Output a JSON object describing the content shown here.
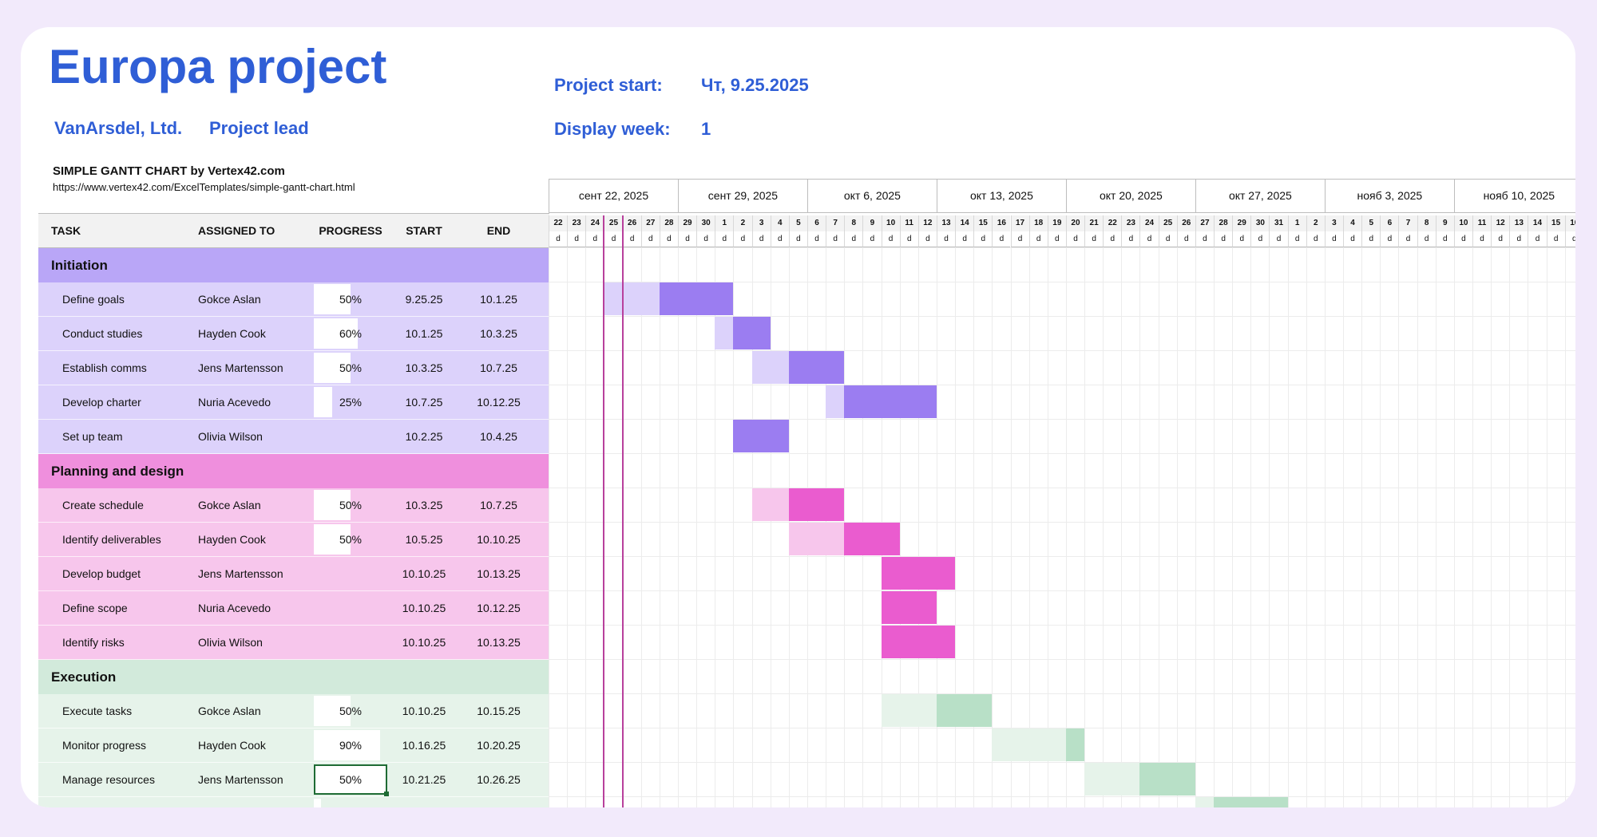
{
  "project": {
    "title": "Europa project",
    "company": "VanArsdel, Ltd.",
    "lead_label": "Project lead",
    "start_label": "Project start:",
    "start_value": "Чт, 9.25.2025",
    "week_label": "Display week:",
    "week_value": "1",
    "credit": "SIMPLE GANTT CHART by Vertex42.com",
    "credit_url": "https://www.vertex42.com/ExcelTemplates/simple-gantt-chart.html"
  },
  "columns": [
    "TASK",
    "ASSIGNED TO",
    "PROGRESS",
    "START",
    "END"
  ],
  "weeks": [
    "сент 22, 2025",
    "сент 29, 2025",
    "окт 6, 2025",
    "окт 13, 2025",
    "окт 20, 2025",
    "окт 27, 2025",
    "нояб 3, 2025",
    "нояб 10, 2025"
  ],
  "days": [
    "22",
    "23",
    "24",
    "25",
    "26",
    "27",
    "28",
    "29",
    "30",
    "1",
    "2",
    "3",
    "4",
    "5",
    "6",
    "7",
    "8",
    "9",
    "10",
    "11",
    "12",
    "13",
    "14",
    "15",
    "16",
    "17",
    "18",
    "19",
    "20",
    "21",
    "22",
    "23",
    "24",
    "25",
    "26",
    "27",
    "28",
    "29",
    "30",
    "31",
    "1",
    "2",
    "3",
    "4",
    "5",
    "6",
    "7",
    "8",
    "9",
    "10",
    "11",
    "12",
    "13",
    "14",
    "15",
    "16"
  ],
  "day_letter": "d",
  "colors": {
    "purple_header": "#b9a6f7",
    "purple_row": "#dcd2fb",
    "purple_bar": "#9b7df1",
    "purple_light": "#dcd2fb",
    "pink_header": "#ef8fdd",
    "pink_row": "#f7c6ec",
    "pink_bar": "#ea5ccf",
    "pink_light": "#f7c6ec",
    "green_header": "#d2eadb",
    "green_row": "#e6f3ea",
    "green_bar": "#b8e0c7",
    "green_light": "#e6f3ea"
  },
  "phases": [
    {
      "name": "Initiation",
      "color": "purple",
      "tasks": [
        {
          "task": "Define goals",
          "assigned": "Gokce Aslan",
          "progress": "50%",
          "progress_value": 0.5,
          "start": "9.25.25",
          "end": "10.1.25",
          "bar_light": [
            3,
            6
          ],
          "bar_dark": [
            6,
            10
          ]
        },
        {
          "task": "Conduct studies",
          "assigned": "Hayden Cook",
          "progress": "60%",
          "progress_value": 0.6,
          "start": "10.1.25",
          "end": "10.3.25",
          "bar_light": [
            9,
            10
          ],
          "bar_dark": [
            10,
            12
          ]
        },
        {
          "task": "Establish comms",
          "assigned": "Jens Martensson",
          "progress": "50%",
          "progress_value": 0.5,
          "start": "10.3.25",
          "end": "10.7.25",
          "bar_light": [
            11,
            13
          ],
          "bar_dark": [
            13,
            16
          ]
        },
        {
          "task": "Develop charter",
          "assigned": "Nuria Acevedo",
          "progress": "25%",
          "progress_value": 0.25,
          "start": "10.7.25",
          "end": "10.12.25",
          "bar_light": [
            15,
            16
          ],
          "bar_dark": [
            16,
            21
          ]
        },
        {
          "task": "Set up team",
          "assigned": "Olivia Wilson",
          "progress": "",
          "progress_value": 0,
          "start": "10.2.25",
          "end": "10.4.25",
          "bar_light": null,
          "bar_dark": [
            10,
            13
          ]
        }
      ]
    },
    {
      "name": "Planning and design",
      "color": "pink",
      "tasks": [
        {
          "task": "Create schedule",
          "assigned": "Gokce Aslan",
          "progress": "50%",
          "progress_value": 0.5,
          "start": "10.3.25",
          "end": "10.7.25",
          "bar_light": [
            11,
            13
          ],
          "bar_dark": [
            13,
            16
          ]
        },
        {
          "task": "Identify deliverables",
          "assigned": "Hayden Cook",
          "progress": "50%",
          "progress_value": 0.5,
          "start": "10.5.25",
          "end": "10.10.25",
          "bar_light": [
            13,
            16
          ],
          "bar_dark": [
            16,
            19
          ]
        },
        {
          "task": "Develop budget",
          "assigned": "Jens Martensson",
          "progress": "",
          "progress_value": 0,
          "start": "10.10.25",
          "end": "10.13.25",
          "bar_light": null,
          "bar_dark": [
            18,
            22
          ]
        },
        {
          "task": "Define scope",
          "assigned": "Nuria Acevedo",
          "progress": "",
          "progress_value": 0,
          "start": "10.10.25",
          "end": "10.12.25",
          "bar_light": null,
          "bar_dark": [
            18,
            21
          ]
        },
        {
          "task": "Identify risks",
          "assigned": "Olivia Wilson",
          "progress": "",
          "progress_value": 0,
          "start": "10.10.25",
          "end": "10.13.25",
          "bar_light": null,
          "bar_dark": [
            18,
            22
          ]
        }
      ]
    },
    {
      "name": "Execution",
      "color": "green",
      "tasks": [
        {
          "task": "Execute tasks",
          "assigned": "Gokce Aslan",
          "progress": "50%",
          "progress_value": 0.5,
          "start": "10.10.25",
          "end": "10.15.25",
          "bar_light": [
            18,
            21
          ],
          "bar_dark": [
            21,
            24
          ]
        },
        {
          "task": "Monitor progress",
          "assigned": "Hayden Cook",
          "progress": "90%",
          "progress_value": 0.9,
          "start": "10.16.25",
          "end": "10.20.25",
          "bar_light": [
            24,
            28
          ],
          "bar_dark": [
            28,
            29
          ]
        },
        {
          "task": "Manage resources",
          "assigned": "Jens Martensson",
          "progress": "50%",
          "progress_value": 0.5,
          "start": "10.21.25",
          "end": "10.26.25",
          "bar_light": [
            29,
            32
          ],
          "bar_dark": [
            32,
            35
          ],
          "selected": true
        },
        {
          "task": "",
          "assigned": "",
          "progress": "",
          "progress_value": 0.1,
          "start": "",
          "end": "",
          "bar_light": [
            35,
            36
          ],
          "bar_dark": [
            36,
            40
          ]
        }
      ]
    }
  ],
  "today_index": 3
}
